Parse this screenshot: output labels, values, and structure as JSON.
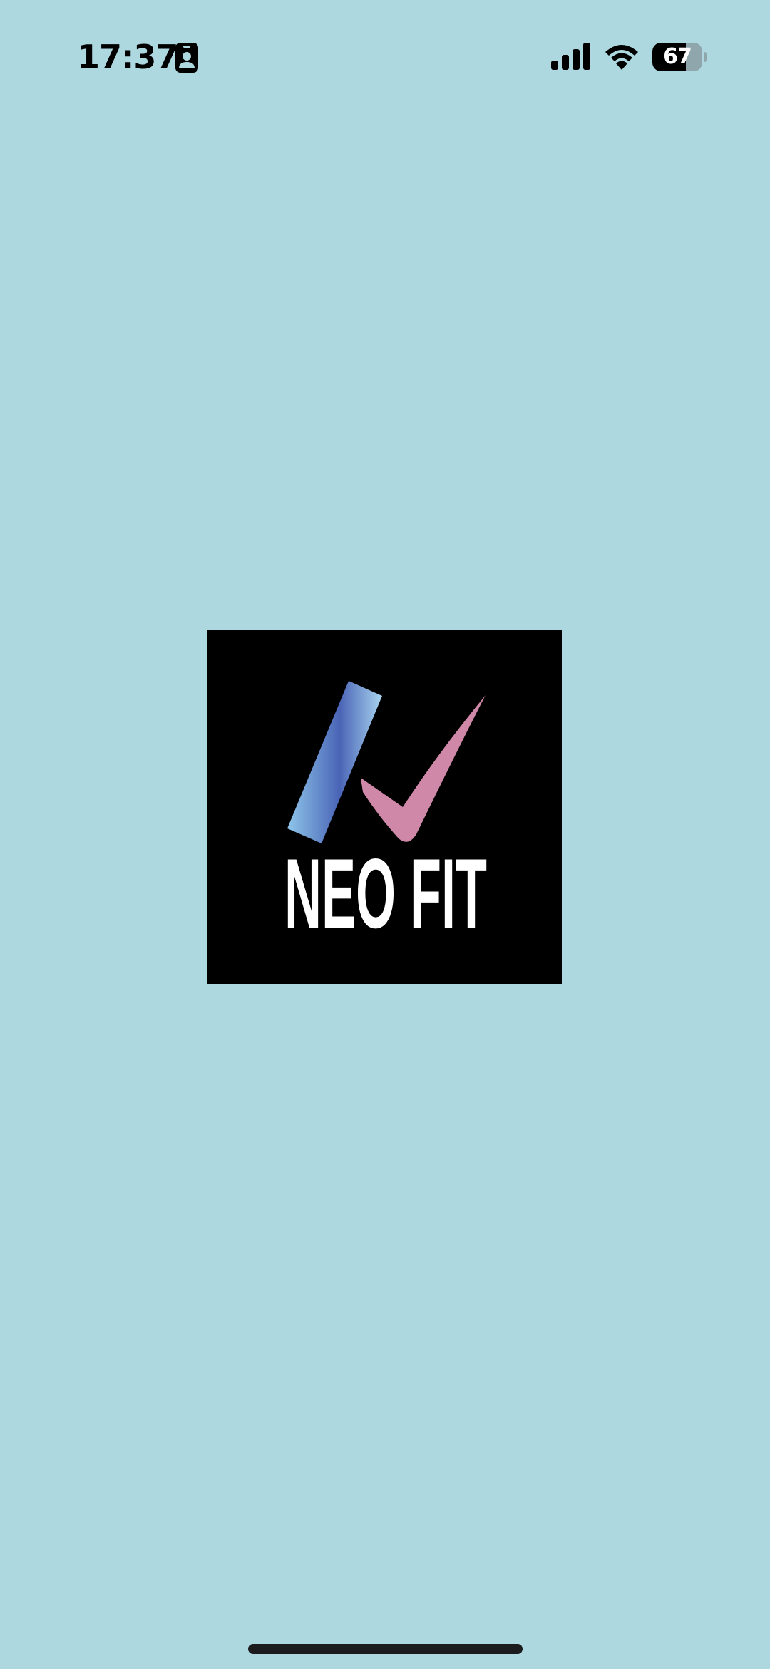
{
  "status_bar": {
    "time": "17:37",
    "battery_percent": 67,
    "battery_label": "67",
    "icons": [
      "contact-badge-icon",
      "cellular-signal-icon",
      "wifi-icon",
      "battery-icon"
    ]
  },
  "splash": {
    "logo_text": "NEO FIT",
    "logo_mark": "checkmark-logo",
    "colors": {
      "background": "#add8e0",
      "logo_background": "#000000",
      "blue_bar": "#4a78c8",
      "pink_check": "#cf88a8"
    }
  }
}
